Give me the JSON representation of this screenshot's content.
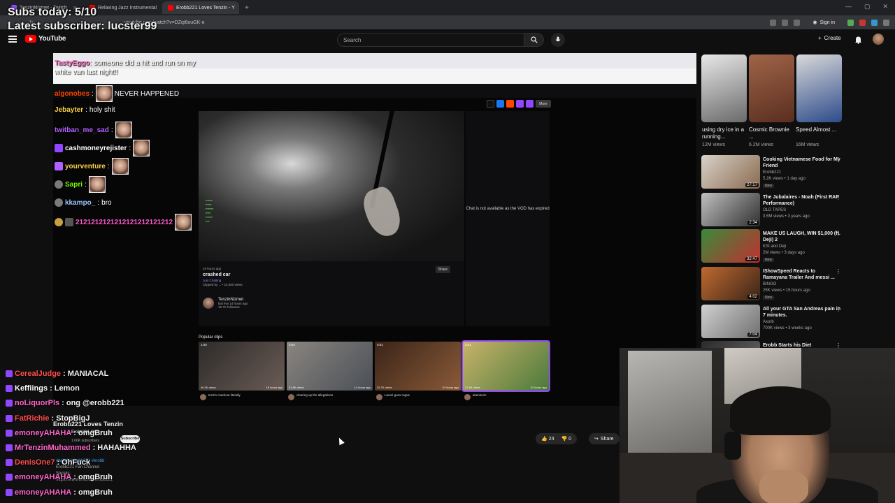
{
  "stream_overlay": {
    "subs_today": "Subs today: 5/10",
    "latest_subscriber": "Latest subscriber: lucster99"
  },
  "browser": {
    "tabs": [
      {
        "label": "TenzinNizmet - Twitch",
        "active": false
      },
      {
        "label": "Relaxing Jazz Instrumental",
        "active": false
      },
      {
        "label": "Erobb221 Loves Tenzin - Y",
        "active": true
      }
    ],
    "url": "youtube.com/watch?v=DZqi6ouGK-o",
    "sign_in": "Sign in"
  },
  "masthead": {
    "logo": "YouTube",
    "search_placeholder": "Search",
    "create_label": "Create"
  },
  "inner_clip": {
    "chat_unavailable": "Chat is not available as the VOD has expired",
    "clip_ago": "18 hours ago",
    "clip_title": "crashed car",
    "clip_category": "Just Chatting",
    "clip_byline": "Clipped by ... • 22,000 views",
    "share_label": "Share",
    "more_label": "More",
    "channel_name": "TenzinNizmet",
    "channel_followers": "18.7K followers",
    "channel_live": "last live 14 hours ago",
    "popular_clips_label": "Popular clips",
    "thumbs": [
      {
        "duration": "1:00",
        "views": "46.3K views",
        "ago": "18 hours ago",
        "caption": "tenzin crashout literally",
        "color1": "#2d2b2a",
        "color2": "#6b5c55"
      },
      {
        "duration": "0:54",
        "views": "31.8K views",
        "ago": "14 hours ago",
        "caption": "clearing up the allegations",
        "color1": "#8a8580",
        "color2": "#4a4f56"
      },
      {
        "duration": "0:51",
        "views": "32.7K views",
        "ago": "21 hours ago",
        "caption": "Lacari goes rogue",
        "color1": "#3a2418",
        "color2": "#8a5a38"
      },
      {
        "duration": "0:51",
        "views": "27.9K views",
        "ago": "21 hours ago",
        "caption": "aluminum",
        "color1": "#c9b36a",
        "color2": "#4a7a3a"
      }
    ]
  },
  "chat_overlay_top": [
    {
      "user": "TastyEggo",
      "text": "someone did a hit and run on my white van last night!!",
      "color": "#ff6ec7"
    },
    {
      "user": "algonobes",
      "text": "NEVER HAPPENED",
      "color": "#ff4500"
    },
    {
      "user": "Jebayter",
      "text": "holy shit",
      "color": "#ffd34e"
    },
    {
      "user": "twitban_me_sad",
      "text": "",
      "color": "#b060ff"
    },
    {
      "user": "cashmoneyrejister",
      "text": "",
      "color": "#ffffff"
    },
    {
      "user": "yourventure",
      "text": "",
      "color": "#ffd34e"
    },
    {
      "user": "Sapri",
      "text": "",
      "color": "#7cfc00"
    },
    {
      "user": "kkampo_",
      "text": "bro",
      "color": "#9ac7ff"
    },
    {
      "user": "",
      "text": "2121212121212121212121212",
      "color": "#ff5ad1"
    }
  ],
  "chat_overlay_bottom": [
    {
      "user": "CerealJudge",
      "text": "MANIACAL",
      "color": "#ff4d4d"
    },
    {
      "user": "Keffiings",
      "text": "Lemon",
      "color": "#ffffff"
    },
    {
      "user": "noLiquorPls",
      "text": "ong @erobb221",
      "color": "#ff66cc"
    },
    {
      "user": "FatRichie",
      "text": "StopBigJ",
      "color": "#ff4d4d"
    },
    {
      "user": "emoneyAHAHA",
      "text": "omgBruh",
      "color": "#ff66cc"
    },
    {
      "user": "MrTenzinMuhammed",
      "text": "HAHAHHA",
      "color": "#ff66cc"
    },
    {
      "user": "DenisOne7",
      "text": "OhFuck",
      "color": "#ff4d4d"
    },
    {
      "user": "emoneyAHAHA",
      "text": "omgBruh",
      "color": "#ff66cc"
    },
    {
      "user": "emoneyAHAHA",
      "text": "omgBruh",
      "color": "#ff66cc"
    }
  ],
  "video_info": {
    "title": "Erobb221 Loves Tenzin",
    "channel": "Erobb221 Clips",
    "subscribers": "1.66K subscribers",
    "subscribe_label": "Subscribe",
    "likes": "24",
    "dislikes": "0",
    "share_label": "Share",
    "views_tags": "#twitch #erobb221 #erobb",
    "desc_line1": "Erobb221 Fan Channel",
    "desc_line2": "Socials:",
    "desc_line3": "https://www.twitch.tv/erobb221"
  },
  "shorts": [
    {
      "caption": "using dry ice in a running...",
      "views": "12M views",
      "c1": "#e8e8e8",
      "c2": "#6a6a6a"
    },
    {
      "caption": "Cosmic Brownie ...",
      "views": "6.2M views",
      "c1": "#a06448",
      "c2": "#5a2e20"
    },
    {
      "caption": "Speed Almost ...",
      "views": "16M views",
      "c1": "#d9d9d9",
      "c2": "#2d4b8a"
    }
  ],
  "recommendations": [
    {
      "title": "Cooking Vietnamese Food for My Friend",
      "channel": "Erobb221",
      "meta": "5.2K views • 1 day ago",
      "new": "New",
      "duration": "27:17",
      "c1": "#d8d2c8",
      "c2": "#8a6a50"
    },
    {
      "title": "The Jubalaires - Noah (First RAP Performance)",
      "channel": "OLD TAPES",
      "meta": "3.5M views • 3 years ago",
      "new": "",
      "duration": "2:34",
      "c1": "#c0c0c0",
      "c2": "#303030"
    },
    {
      "title": "MAKE US LAUGH, WIN $1,000 (ft. Deji) 2",
      "channel": "KSI and Deji",
      "meta": "2M views • 3 days ago",
      "new": "New",
      "duration": "32:47",
      "c1": "#3a8a3a",
      "c2": "#c03030"
    },
    {
      "title": "IShowSpeed Reacts to Ramayana Trailer And messi ...",
      "channel": "BINGO",
      "meta": "25K views • 15 hours ago",
      "new": "New",
      "duration": "4:02",
      "c1": "#c06a30",
      "c2": "#3a2418"
    },
    {
      "title": "All your GTA San Andreas pain in 7 minutes.",
      "channel": "Axorb",
      "meta": "700K views • 3 weeks ago",
      "new": "",
      "duration": "7:04",
      "c1": "#d0d0d0",
      "c2": "#707070"
    },
    {
      "title": "Erobb Starts his Diet",
      "channel": "",
      "meta": "",
      "new": "",
      "duration": "",
      "c1": "#2a2a2a",
      "c2": "#6a6a6a"
    }
  ]
}
